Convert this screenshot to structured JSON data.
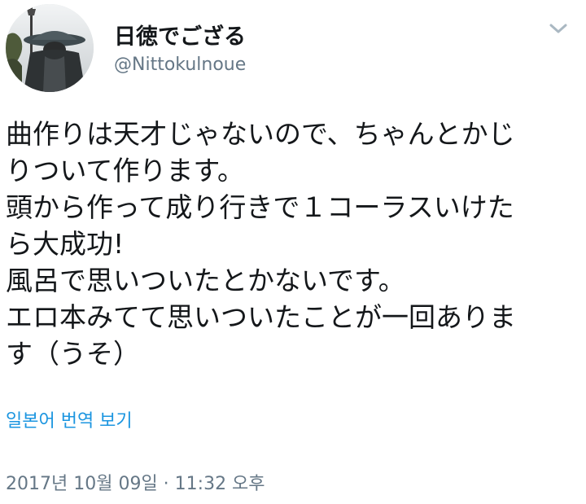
{
  "user": {
    "display_name": "日徳でござる",
    "handle": "@Nittokulnoue"
  },
  "tweet": {
    "lines": [
      "曲作りは天才じゃないので、ちゃんとかじ",
      "りついて作ります。",
      "頭から作って成り行きで１コーラスいけた",
      "ら大成功!",
      "風呂で思いついたとかないです。",
      "エロ本みてて思いついたことが一回ありま",
      "す（うそ）"
    ]
  },
  "translate_label": "일본어 번역 보기",
  "timestamp": "2017년 10월 09일 · 11:32 오후",
  "icons": {
    "menu": "chevron-down-icon",
    "avatar": "avatar-photo"
  },
  "colors": {
    "link": "#1b95e0",
    "secondary_text": "#657786",
    "primary_text": "#14171a",
    "chevron": "#aab8c2"
  }
}
